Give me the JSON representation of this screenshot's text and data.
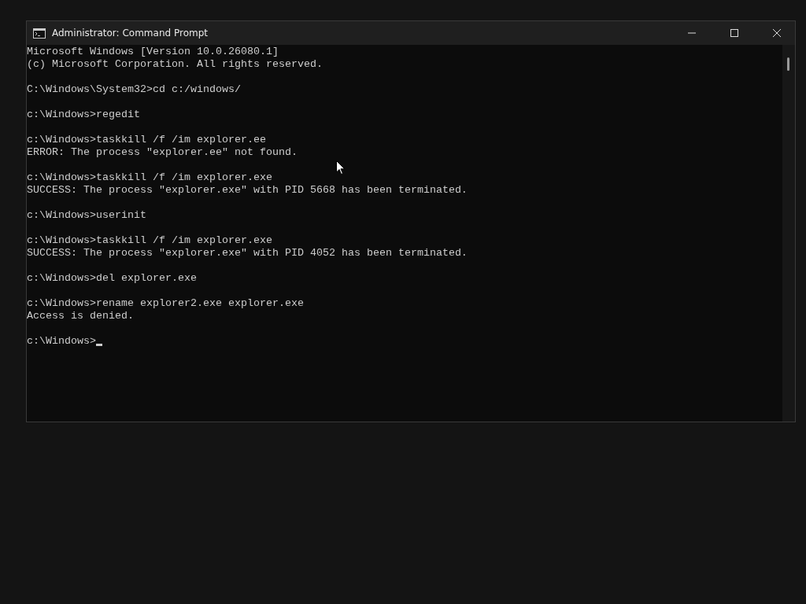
{
  "window": {
    "title": "Administrator: Command Prompt"
  },
  "console": {
    "blocks": [
      [
        "Microsoft Windows [Version 10.0.26080.1]",
        "(c) Microsoft Corporation. All rights reserved."
      ],
      [
        "C:\\Windows\\System32>cd c:/windows/"
      ],
      [
        "c:\\Windows>regedit"
      ],
      [
        "c:\\Windows>taskkill /f /im explorer.ee",
        "ERROR: The process \"explorer.ee\" not found."
      ],
      [
        "c:\\Windows>taskkill /f /im explorer.exe",
        "SUCCESS: The process \"explorer.exe\" with PID 5668 has been terminated."
      ],
      [
        "c:\\Windows>userinit"
      ],
      [
        "c:\\Windows>taskkill /f /im explorer.exe",
        "SUCCESS: The process \"explorer.exe\" with PID 4052 has been terminated."
      ],
      [
        "c:\\Windows>del explorer.exe"
      ],
      [
        "c:\\Windows>rename explorer2.exe explorer.exe",
        "Access is denied."
      ]
    ],
    "prompt": "c:\\Windows>"
  }
}
